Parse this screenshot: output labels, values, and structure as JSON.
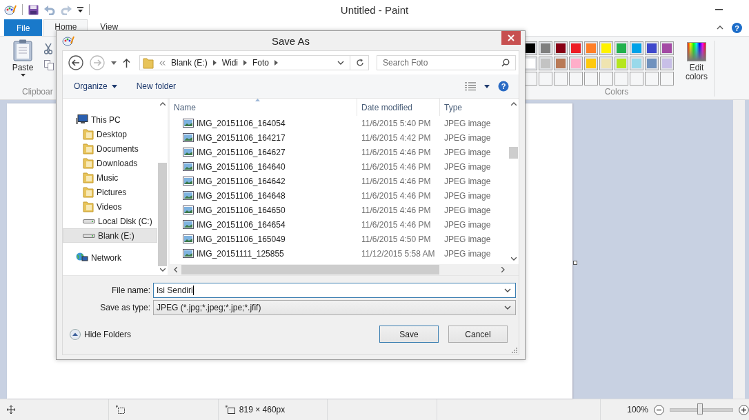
{
  "app": {
    "title": "Untitled - Paint",
    "help": "?"
  },
  "tabs": [
    {
      "label": "File",
      "kind": "file",
      "selected": false
    },
    {
      "label": "Home",
      "kind": "tab",
      "selected": true
    },
    {
      "label": "View",
      "kind": "tab",
      "selected": false
    }
  ],
  "ribbon": {
    "paste_label": "Paste",
    "clipboard_group": "Clipboar",
    "edit_colors": "Edit colors",
    "colors_group": "Colors",
    "palette": [
      {
        "color": "#000000"
      },
      {
        "color": "#7f7f7f"
      },
      {
        "color": "#880015"
      },
      {
        "color": "#ed1c24"
      },
      {
        "color": "#ff7f27"
      },
      {
        "color": "#fff200"
      },
      {
        "color": "#22b14c"
      },
      {
        "color": "#00a2e8"
      },
      {
        "color": "#3f48cc"
      },
      {
        "color": "#a349a4"
      },
      {
        "color": "#ffffff"
      },
      {
        "color": "#c3c3c3"
      },
      {
        "color": "#b97a57"
      },
      {
        "color": "#ffaec9"
      },
      {
        "color": "#ffc90e"
      },
      {
        "color": "#efe4b0"
      },
      {
        "color": "#b5e61d"
      },
      {
        "color": "#99d9ea"
      },
      {
        "color": "#7092be"
      },
      {
        "color": "#c8bfe7"
      }
    ]
  },
  "dialog": {
    "title": "Save As",
    "breadcrumb": [
      "Blank (E:)",
      "Widi",
      "Foto"
    ],
    "search_placeholder": "Search Foto",
    "toolbar": {
      "organize": "Organize",
      "new_folder": "New folder"
    },
    "tree": [
      {
        "label": "This PC",
        "kind": "computer",
        "selected": false,
        "children": [
          {
            "label": "Desktop",
            "kind": "folder",
            "selected": false
          },
          {
            "label": "Documents",
            "kind": "folder",
            "selected": false
          },
          {
            "label": "Downloads",
            "kind": "folder",
            "selected": false
          },
          {
            "label": "Music",
            "kind": "folder",
            "selected": false
          },
          {
            "label": "Pictures",
            "kind": "folder",
            "selected": false
          },
          {
            "label": "Videos",
            "kind": "folder",
            "selected": false
          },
          {
            "label": "Local Disk (C:)",
            "kind": "drive",
            "selected": false
          },
          {
            "label": "Blank (E:)",
            "kind": "drive",
            "selected": true
          }
        ]
      },
      {
        "label": "Network",
        "kind": "network",
        "selected": false
      }
    ],
    "columns": [
      "Name",
      "Date modified",
      "Type"
    ],
    "rows": [
      {
        "name": "IMG_20151106_164054",
        "date": "11/6/2015 5:40 PM",
        "type": "JPEG image"
      },
      {
        "name": "IMG_20151106_164217",
        "date": "11/6/2015 4:42 PM",
        "type": "JPEG image"
      },
      {
        "name": "IMG_20151106_164627",
        "date": "11/6/2015 4:46 PM",
        "type": "JPEG image"
      },
      {
        "name": "IMG_20151106_164640",
        "date": "11/6/2015 4:46 PM",
        "type": "JPEG image"
      },
      {
        "name": "IMG_20151106_164642",
        "date": "11/6/2015 4:46 PM",
        "type": "JPEG image"
      },
      {
        "name": "IMG_20151106_164648",
        "date": "11/6/2015 4:46 PM",
        "type": "JPEG image"
      },
      {
        "name": "IMG_20151106_164650",
        "date": "11/6/2015 4:46 PM",
        "type": "JPEG image"
      },
      {
        "name": "IMG_20151106_164654",
        "date": "11/6/2015 4:46 PM",
        "type": "JPEG image"
      },
      {
        "name": "IMG_20151106_165049",
        "date": "11/6/2015 4:50 PM",
        "type": "JPEG image"
      },
      {
        "name": "IMG_20151111_125855",
        "date": "11/12/2015 5:58 AM",
        "type": "JPEG image"
      }
    ],
    "file_name_label": "File name:",
    "file_name": "Isi Sendiri",
    "type_label": "Save as type:",
    "type_value": "JPEG (*.jpg;*.jpeg;*.jpe;*.jfif)",
    "hide_folders": "Hide Folders",
    "save": "Save",
    "cancel": "Cancel",
    "help": "?"
  },
  "status_bar": {
    "size": "819 × 460px",
    "zoom": "100%",
    "zoom_slider": {
      "level": 0.48
    }
  }
}
